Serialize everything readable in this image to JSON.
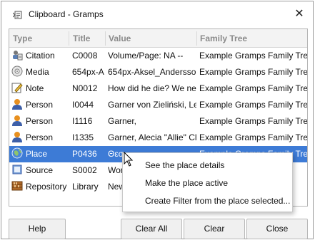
{
  "window": {
    "title": "Clipboard - Gramps",
    "close_glyph": "✕"
  },
  "columns": [
    "Type",
    "Title",
    "Value",
    "Family Tree"
  ],
  "rows": [
    {
      "icon": "citation-icon",
      "type": "Citation",
      "title": "C0008",
      "value": "Volume/Page: NA --",
      "tree": "Example Gramps Family Tree"
    },
    {
      "icon": "media-icon",
      "type": "Media",
      "title": "654px-A",
      "value": "654px-Aksel_Andersson",
      "tree": "Example Gramps Family Tree"
    },
    {
      "icon": "note-icon",
      "type": "Note",
      "title": "N0012",
      "value": "How did he die? We nee",
      "tree": "Example Gramps Family Tree"
    },
    {
      "icon": "person-icon",
      "type": "Person",
      "title": "I0044",
      "value": "Garner von Zieliński, Le",
      "tree": "Example Gramps Family Tree"
    },
    {
      "icon": "person-icon",
      "type": "Person",
      "title": "I1116",
      "value": "Garner,",
      "tree": "Example Gramps Family Tree"
    },
    {
      "icon": "person-icon",
      "type": "Person",
      "title": "I1335",
      "value": "Garner, Alecia \"Allie\" Cl",
      "tree": "Example Gramps Family Tree"
    },
    {
      "icon": "place-icon",
      "type": "Place",
      "title": "P0436",
      "value": "Θεσ",
      "tree": "Example Gramps Family Tree",
      "selected": true
    },
    {
      "icon": "source-icon",
      "type": "Source",
      "title": "S0002",
      "value": "Wor",
      "tree": ""
    },
    {
      "icon": "repository-icon",
      "type": "Repository",
      "title": "Library",
      "value": "New",
      "tree": ""
    }
  ],
  "context_menu": [
    "See the place details",
    "Make the place active",
    "Create Filter from the place selected..."
  ],
  "buttons": {
    "help": "Help",
    "clear_all": "Clear All",
    "clear": "Clear",
    "close": "Close"
  },
  "colors": {
    "selection": "#3d7bd6",
    "person": "#e8901f",
    "place": "#4a86d8"
  }
}
